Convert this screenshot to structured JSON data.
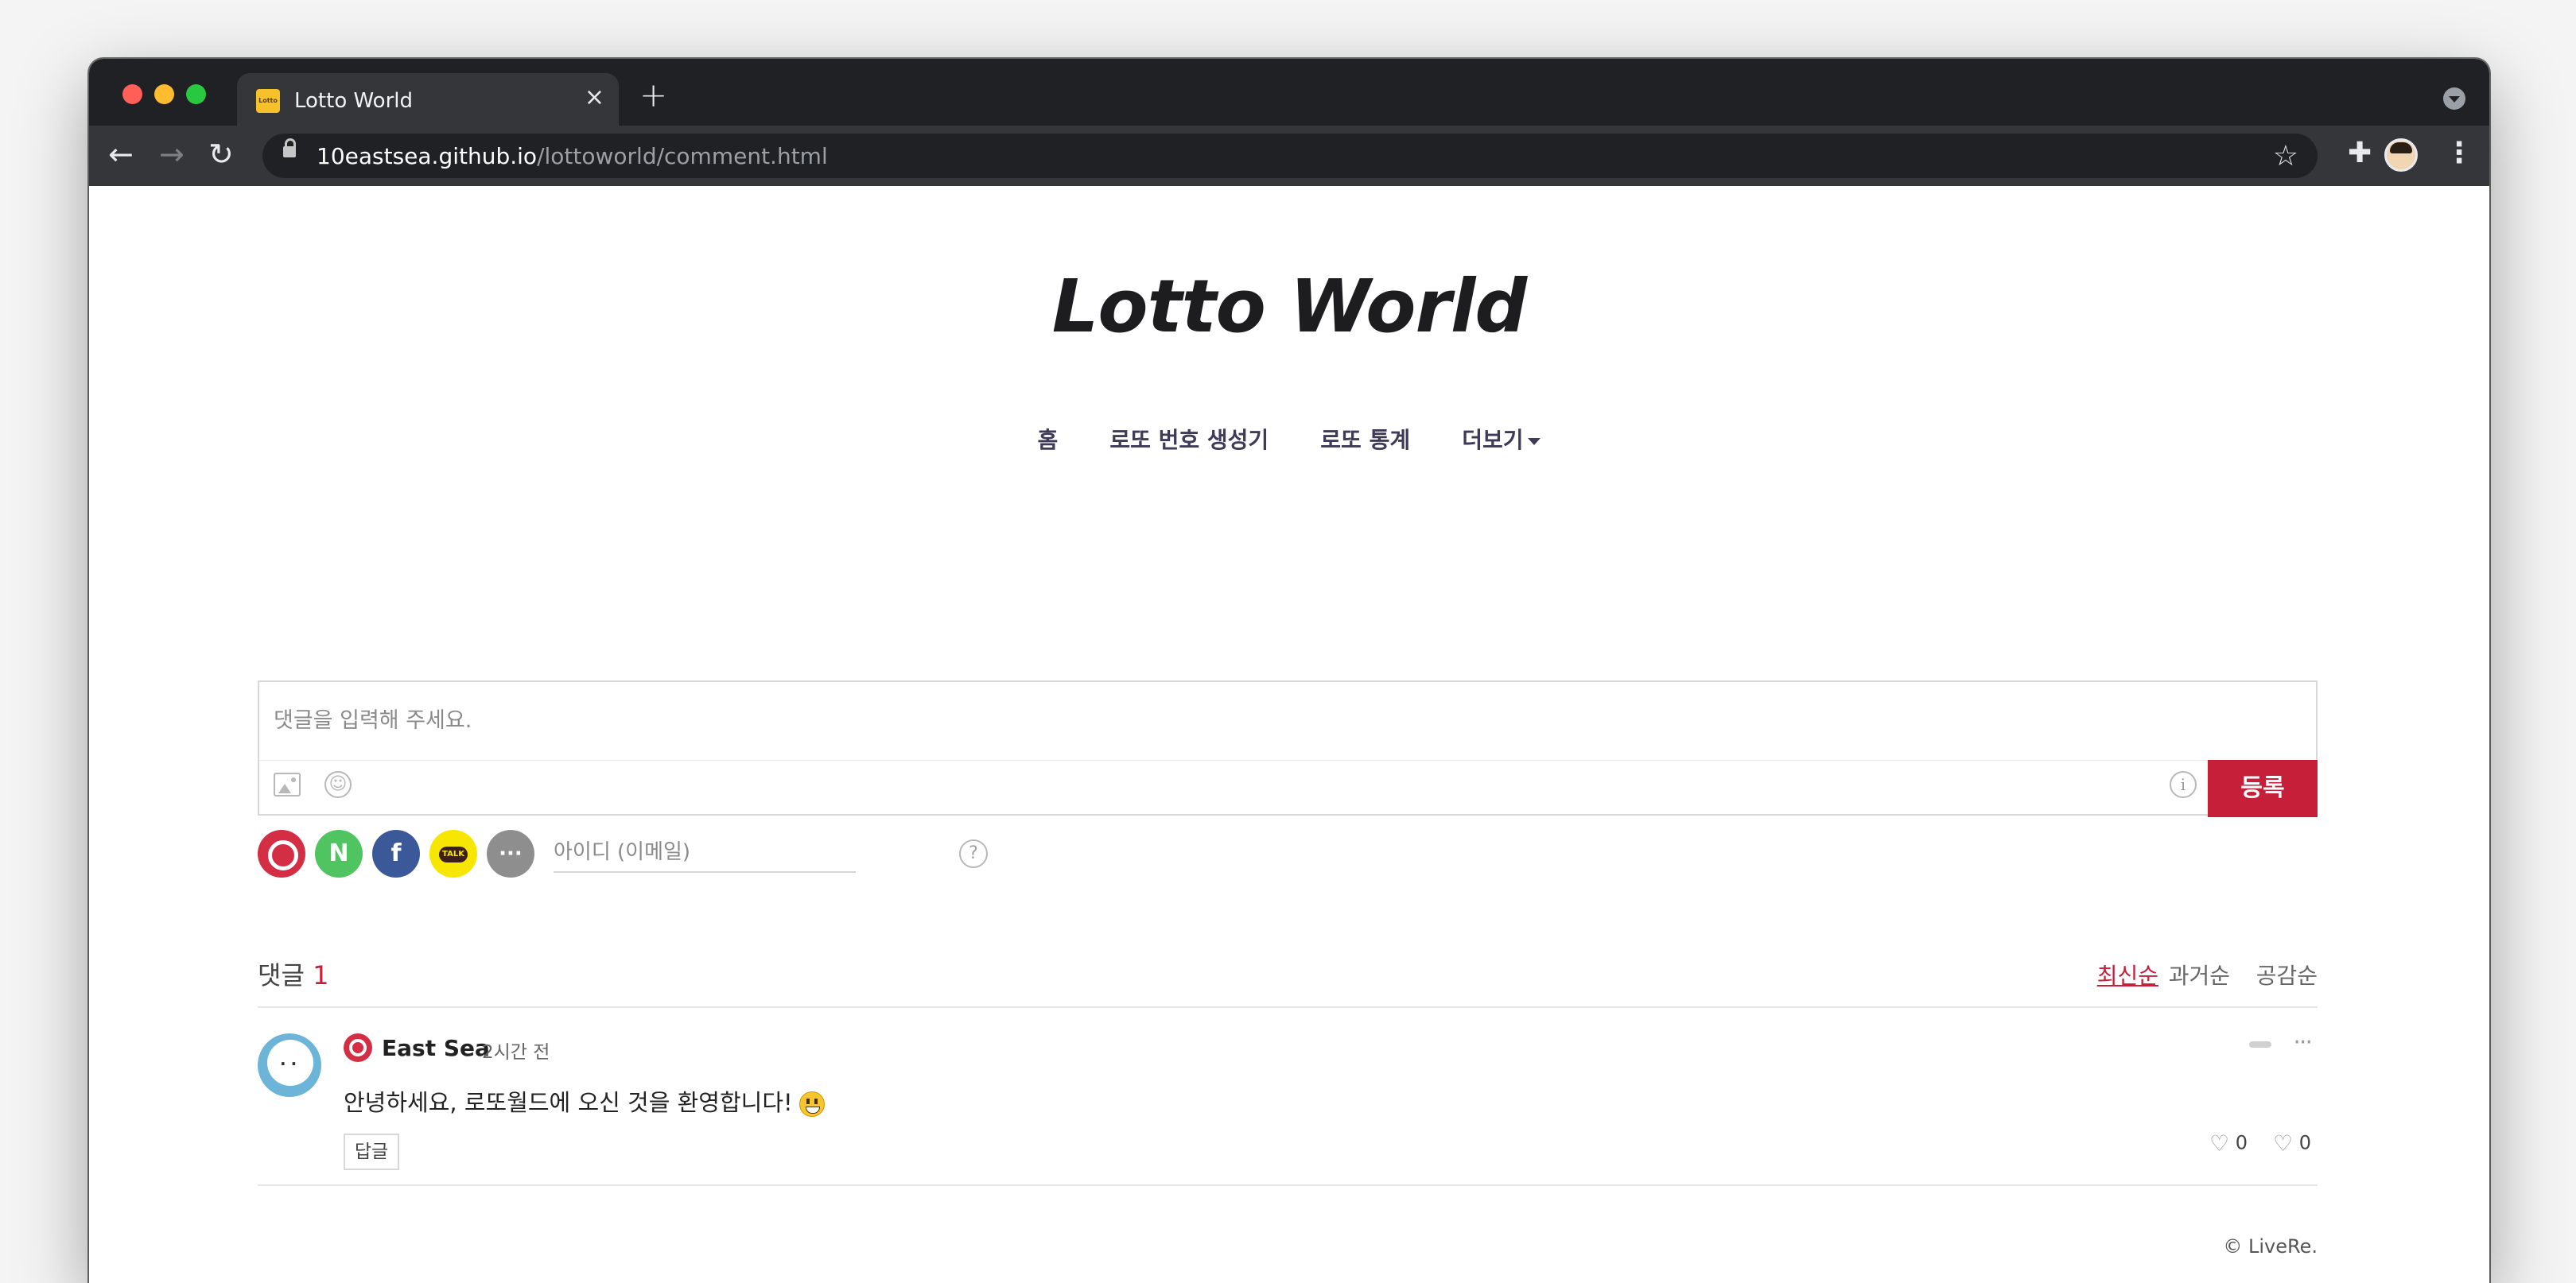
{
  "browser": {
    "tab_title": "Lotto World",
    "favicon_text": "Lotto",
    "url_host": "10eastsea.github.io",
    "url_path": "/lottoworld/comment.html"
  },
  "site": {
    "title": "Lotto World",
    "nav": [
      "홈",
      "로또 번호 생성기",
      "로또 통계",
      "더보기"
    ]
  },
  "comment_form": {
    "placeholder": "댓글을 입력해 주세요.",
    "submit_label": "등록",
    "id_placeholder": "아이디 (이메일)",
    "sns_more": "···",
    "sns_naver": "N",
    "sns_facebook": "f",
    "sns_kakao": "TALK",
    "help": "?",
    "info": "i"
  },
  "comments_header": {
    "label": "댓글",
    "count": "1",
    "sort_options": [
      "최신순",
      "과거순",
      "공감순"
    ],
    "active_sort": "최신순"
  },
  "comment": {
    "author": "East Sea",
    "time": "2시간 전",
    "text": "안녕하세요, 로또월드에 오신 것을 환영합니다!",
    "reply_label": "답글",
    "likes": "0",
    "dislikes": "0"
  },
  "credit": "© LiveRe.",
  "colors": {
    "accent": "#c51f3a",
    "nav_text": "#3e3a57",
    "chrome_dark": "#202124",
    "chrome_toolbar": "#35363a"
  },
  "icons": {
    "back": "arrow-left-icon",
    "forward": "arrow-right-icon",
    "reload": "reload-icon",
    "bookmark": "star-icon",
    "extensions": "puzzle-icon",
    "menu": "kebab-icon"
  }
}
